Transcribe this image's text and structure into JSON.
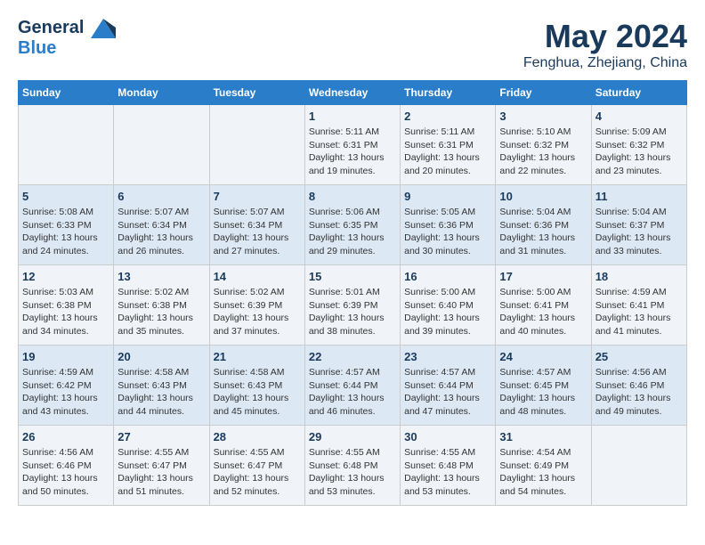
{
  "header": {
    "logo_line1": "General",
    "logo_line2": "Blue",
    "title": "May 2024",
    "subtitle": "Fenghua, Zhejiang, China"
  },
  "days_of_week": [
    "Sunday",
    "Monday",
    "Tuesday",
    "Wednesday",
    "Thursday",
    "Friday",
    "Saturday"
  ],
  "weeks": [
    [
      {
        "day": "",
        "info": ""
      },
      {
        "day": "",
        "info": ""
      },
      {
        "day": "",
        "info": ""
      },
      {
        "day": "1",
        "info": "Sunrise: 5:11 AM\nSunset: 6:31 PM\nDaylight: 13 hours\nand 19 minutes."
      },
      {
        "day": "2",
        "info": "Sunrise: 5:11 AM\nSunset: 6:31 PM\nDaylight: 13 hours\nand 20 minutes."
      },
      {
        "day": "3",
        "info": "Sunrise: 5:10 AM\nSunset: 6:32 PM\nDaylight: 13 hours\nand 22 minutes."
      },
      {
        "day": "4",
        "info": "Sunrise: 5:09 AM\nSunset: 6:32 PM\nDaylight: 13 hours\nand 23 minutes."
      }
    ],
    [
      {
        "day": "5",
        "info": "Sunrise: 5:08 AM\nSunset: 6:33 PM\nDaylight: 13 hours\nand 24 minutes."
      },
      {
        "day": "6",
        "info": "Sunrise: 5:07 AM\nSunset: 6:34 PM\nDaylight: 13 hours\nand 26 minutes."
      },
      {
        "day": "7",
        "info": "Sunrise: 5:07 AM\nSunset: 6:34 PM\nDaylight: 13 hours\nand 27 minutes."
      },
      {
        "day": "8",
        "info": "Sunrise: 5:06 AM\nSunset: 6:35 PM\nDaylight: 13 hours\nand 29 minutes."
      },
      {
        "day": "9",
        "info": "Sunrise: 5:05 AM\nSunset: 6:36 PM\nDaylight: 13 hours\nand 30 minutes."
      },
      {
        "day": "10",
        "info": "Sunrise: 5:04 AM\nSunset: 6:36 PM\nDaylight: 13 hours\nand 31 minutes."
      },
      {
        "day": "11",
        "info": "Sunrise: 5:04 AM\nSunset: 6:37 PM\nDaylight: 13 hours\nand 33 minutes."
      }
    ],
    [
      {
        "day": "12",
        "info": "Sunrise: 5:03 AM\nSunset: 6:38 PM\nDaylight: 13 hours\nand 34 minutes."
      },
      {
        "day": "13",
        "info": "Sunrise: 5:02 AM\nSunset: 6:38 PM\nDaylight: 13 hours\nand 35 minutes."
      },
      {
        "day": "14",
        "info": "Sunrise: 5:02 AM\nSunset: 6:39 PM\nDaylight: 13 hours\nand 37 minutes."
      },
      {
        "day": "15",
        "info": "Sunrise: 5:01 AM\nSunset: 6:39 PM\nDaylight: 13 hours\nand 38 minutes."
      },
      {
        "day": "16",
        "info": "Sunrise: 5:00 AM\nSunset: 6:40 PM\nDaylight: 13 hours\nand 39 minutes."
      },
      {
        "day": "17",
        "info": "Sunrise: 5:00 AM\nSunset: 6:41 PM\nDaylight: 13 hours\nand 40 minutes."
      },
      {
        "day": "18",
        "info": "Sunrise: 4:59 AM\nSunset: 6:41 PM\nDaylight: 13 hours\nand 41 minutes."
      }
    ],
    [
      {
        "day": "19",
        "info": "Sunrise: 4:59 AM\nSunset: 6:42 PM\nDaylight: 13 hours\nand 43 minutes."
      },
      {
        "day": "20",
        "info": "Sunrise: 4:58 AM\nSunset: 6:43 PM\nDaylight: 13 hours\nand 44 minutes."
      },
      {
        "day": "21",
        "info": "Sunrise: 4:58 AM\nSunset: 6:43 PM\nDaylight: 13 hours\nand 45 minutes."
      },
      {
        "day": "22",
        "info": "Sunrise: 4:57 AM\nSunset: 6:44 PM\nDaylight: 13 hours\nand 46 minutes."
      },
      {
        "day": "23",
        "info": "Sunrise: 4:57 AM\nSunset: 6:44 PM\nDaylight: 13 hours\nand 47 minutes."
      },
      {
        "day": "24",
        "info": "Sunrise: 4:57 AM\nSunset: 6:45 PM\nDaylight: 13 hours\nand 48 minutes."
      },
      {
        "day": "25",
        "info": "Sunrise: 4:56 AM\nSunset: 6:46 PM\nDaylight: 13 hours\nand 49 minutes."
      }
    ],
    [
      {
        "day": "26",
        "info": "Sunrise: 4:56 AM\nSunset: 6:46 PM\nDaylight: 13 hours\nand 50 minutes."
      },
      {
        "day": "27",
        "info": "Sunrise: 4:55 AM\nSunset: 6:47 PM\nDaylight: 13 hours\nand 51 minutes."
      },
      {
        "day": "28",
        "info": "Sunrise: 4:55 AM\nSunset: 6:47 PM\nDaylight: 13 hours\nand 52 minutes."
      },
      {
        "day": "29",
        "info": "Sunrise: 4:55 AM\nSunset: 6:48 PM\nDaylight: 13 hours\nand 53 minutes."
      },
      {
        "day": "30",
        "info": "Sunrise: 4:55 AM\nSunset: 6:48 PM\nDaylight: 13 hours\nand 53 minutes."
      },
      {
        "day": "31",
        "info": "Sunrise: 4:54 AM\nSunset: 6:49 PM\nDaylight: 13 hours\nand 54 minutes."
      },
      {
        "day": "",
        "info": ""
      }
    ]
  ]
}
